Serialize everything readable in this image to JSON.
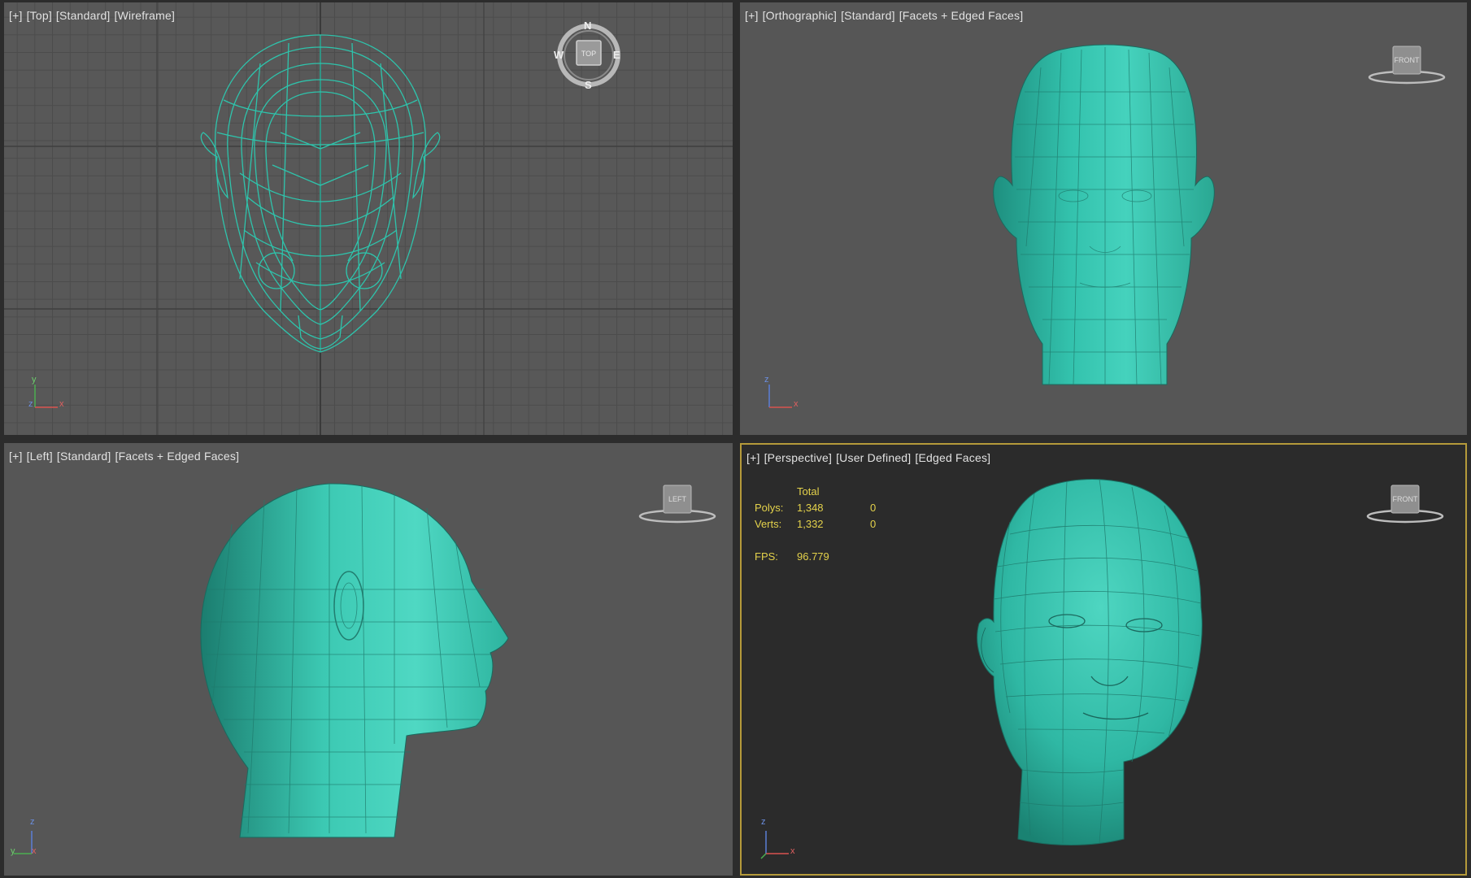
{
  "viewports": {
    "top": {
      "menu": "[+]",
      "view": "[Top]",
      "lighting": "[Standard]",
      "shading": "[Wireframe]",
      "compass": {
        "n": "N",
        "s": "S",
        "e": "E",
        "w": "W",
        "cube": "TOP"
      }
    },
    "front": {
      "menu": "[+]",
      "view": "[Orthographic]",
      "lighting": "[Standard]",
      "shading": "[Facets + Edged Faces]",
      "cube": "FRONT"
    },
    "left": {
      "menu": "[+]",
      "view": "[Left]",
      "lighting": "[Standard]",
      "shading": "[Facets + Edged Faces]",
      "cube": "LEFT"
    },
    "perspective": {
      "menu": "[+]",
      "view": "[Perspective]",
      "lighting": "[User Defined]",
      "shading": "[Edged Faces]",
      "cube": "FRONT",
      "stats": {
        "header": "Total",
        "polys_label": "Polys:",
        "polys_value": "1,348",
        "polys_sel": "0",
        "verts_label": "Verts:",
        "verts_value": "1,332",
        "verts_sel": "0",
        "fps_label": "FPS:",
        "fps_value": "96.779"
      }
    }
  },
  "colors": {
    "model": "#2fb8a4",
    "wire": "#2ec4ac",
    "active_border": "#b59a3a",
    "stats_text": "#e4d24b"
  },
  "axes": {
    "x": "x",
    "y": "y",
    "z": "z"
  }
}
